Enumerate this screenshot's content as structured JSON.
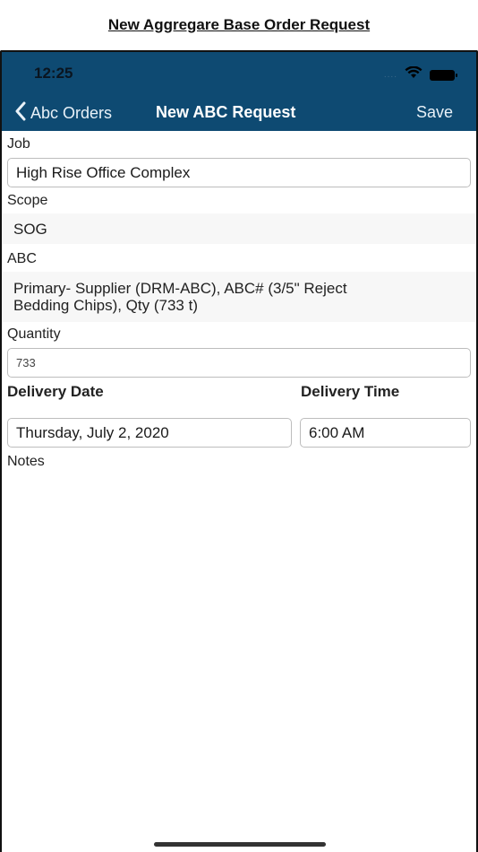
{
  "doc_title": "New Aggregare Base Order Request",
  "status_bar": {
    "time": "12:25",
    "signal_dots": "....",
    "wifi_icon": "wifi-icon",
    "battery_icon": "battery-icon"
  },
  "nav": {
    "back_label": "Abc Orders",
    "title": "New ABC Request",
    "save_label": "Save",
    "color": "#0e4a72"
  },
  "form": {
    "job_label": "Job",
    "job_value": "High Rise Office Complex",
    "scope_label": "Scope",
    "scope_value": "SOG",
    "abc_label": "ABC",
    "abc_line1": "Primary- Supplier (DRM-ABC), ABC# (3/5\" Reject",
    "abc_line2": "Bedding Chips), Qty (733 t)",
    "quantity_label": "Quantity",
    "quantity_value": "733",
    "delivery_date_label": "Delivery Date",
    "delivery_date_value": "Thursday, July 2, 2020",
    "delivery_time_label": "Delivery Time",
    "delivery_time_value": "6:00 AM",
    "notes_label": "Notes"
  }
}
